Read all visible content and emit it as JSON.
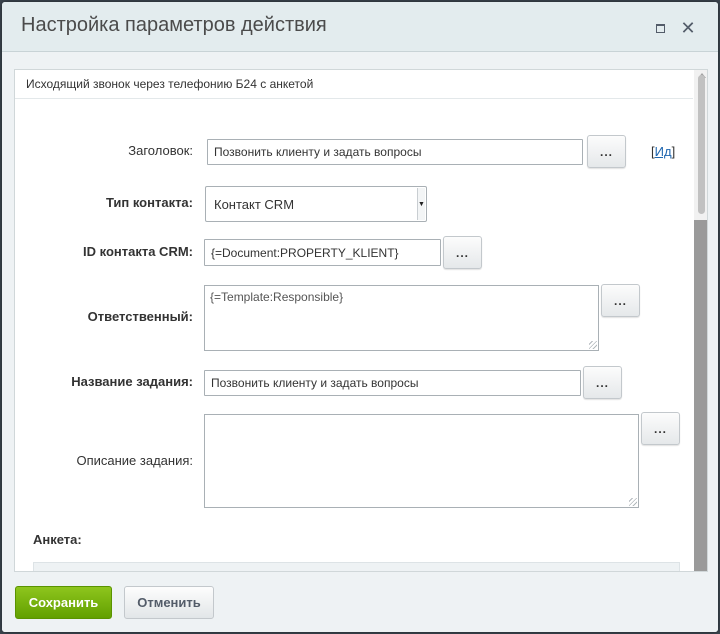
{
  "dialog": {
    "title": "Настройка параметров действия",
    "action_name": "Исходящий звонок через телефонию Б24 с анкетой"
  },
  "form": {
    "header_label": "Заголовок:",
    "header_value": "Позвонить клиенту и задать вопросы",
    "id_link_open": "[",
    "id_link_text": "Ид",
    "id_link_close": "]",
    "contact_type_label": "Тип контакта:",
    "contact_type_value": "Контакт CRM",
    "crm_id_label": "ID контакта CRM:",
    "crm_id_value": "{=Document:PROPERTY_KLIENT}",
    "responsible_label": "Ответственный:",
    "responsible_value": "{=Template:Responsible}",
    "task_name_label": "Название задания:",
    "task_name_value": "Позвонить клиенту и задать вопросы",
    "task_desc_label": "Описание задания:",
    "task_desc_value": "",
    "anketa_label": "Анкета:",
    "dots": "..."
  },
  "footer": {
    "save_label": "Сохранить",
    "cancel_label": "Отменить"
  },
  "icons": {
    "maximize": "maximize-icon",
    "close": "close-icon",
    "close_glyph": "✕"
  },
  "colors": {
    "save_button": "#6aa80a",
    "link": "#2067b0",
    "titlebar": "#e3ecee"
  }
}
